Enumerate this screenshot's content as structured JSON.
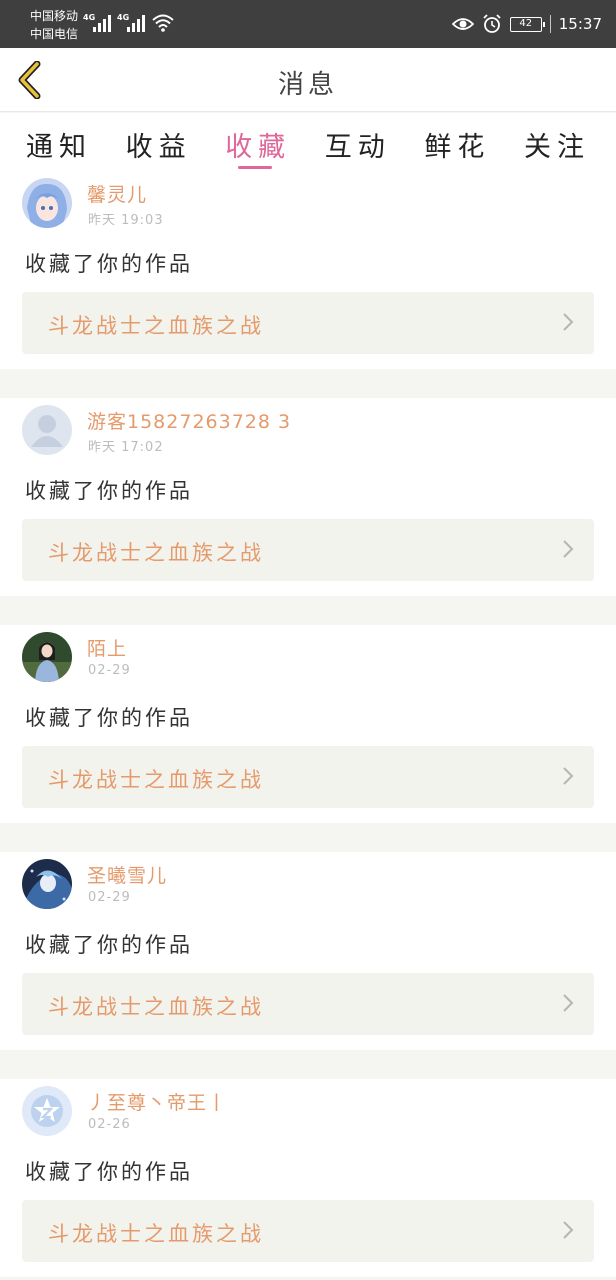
{
  "status_bar": {
    "carrier_1": "中国移动",
    "carrier_2": "中国电信",
    "network_1": "4G",
    "network_2": "4G",
    "battery": "42",
    "time": "15:37",
    "icons": [
      "eye-icon",
      "alarm-icon",
      "wifi-icon",
      "battery-icon"
    ]
  },
  "header": {
    "title": "消息"
  },
  "tabs": [
    {
      "label": "通知",
      "active": false
    },
    {
      "label": "收益",
      "active": false
    },
    {
      "label": "收藏",
      "active": true
    },
    {
      "label": "互动",
      "active": false
    },
    {
      "label": "鲜花",
      "active": false
    },
    {
      "label": "关注",
      "active": false
    }
  ],
  "messages": [
    {
      "username": "馨灵儿",
      "time": "昨天 19:03",
      "action": "收藏了你的作品",
      "work": "斗龙战士之血族之战"
    },
    {
      "username": "游客15827263728 3",
      "time": "昨天 17:02",
      "action": "收藏了你的作品",
      "work": "斗龙战士之血族之战"
    },
    {
      "username": "陌上",
      "time": "02-29",
      "action": "收藏了你的作品",
      "work": "斗龙战士之血族之战"
    },
    {
      "username": "圣曦雪儿",
      "time": "02-29",
      "action": "收藏了你的作品",
      "work": "斗龙战士之血族之战"
    },
    {
      "username": "丿至尊丶帝王丨",
      "time": "02-26",
      "action": "收藏了你的作品",
      "work": "斗龙战士之血族之战"
    }
  ],
  "colors": {
    "accent": "#e0679a",
    "username": "#e59a6b",
    "work_bg": "#f3f3ed",
    "back_icon": "#d4a62a"
  }
}
